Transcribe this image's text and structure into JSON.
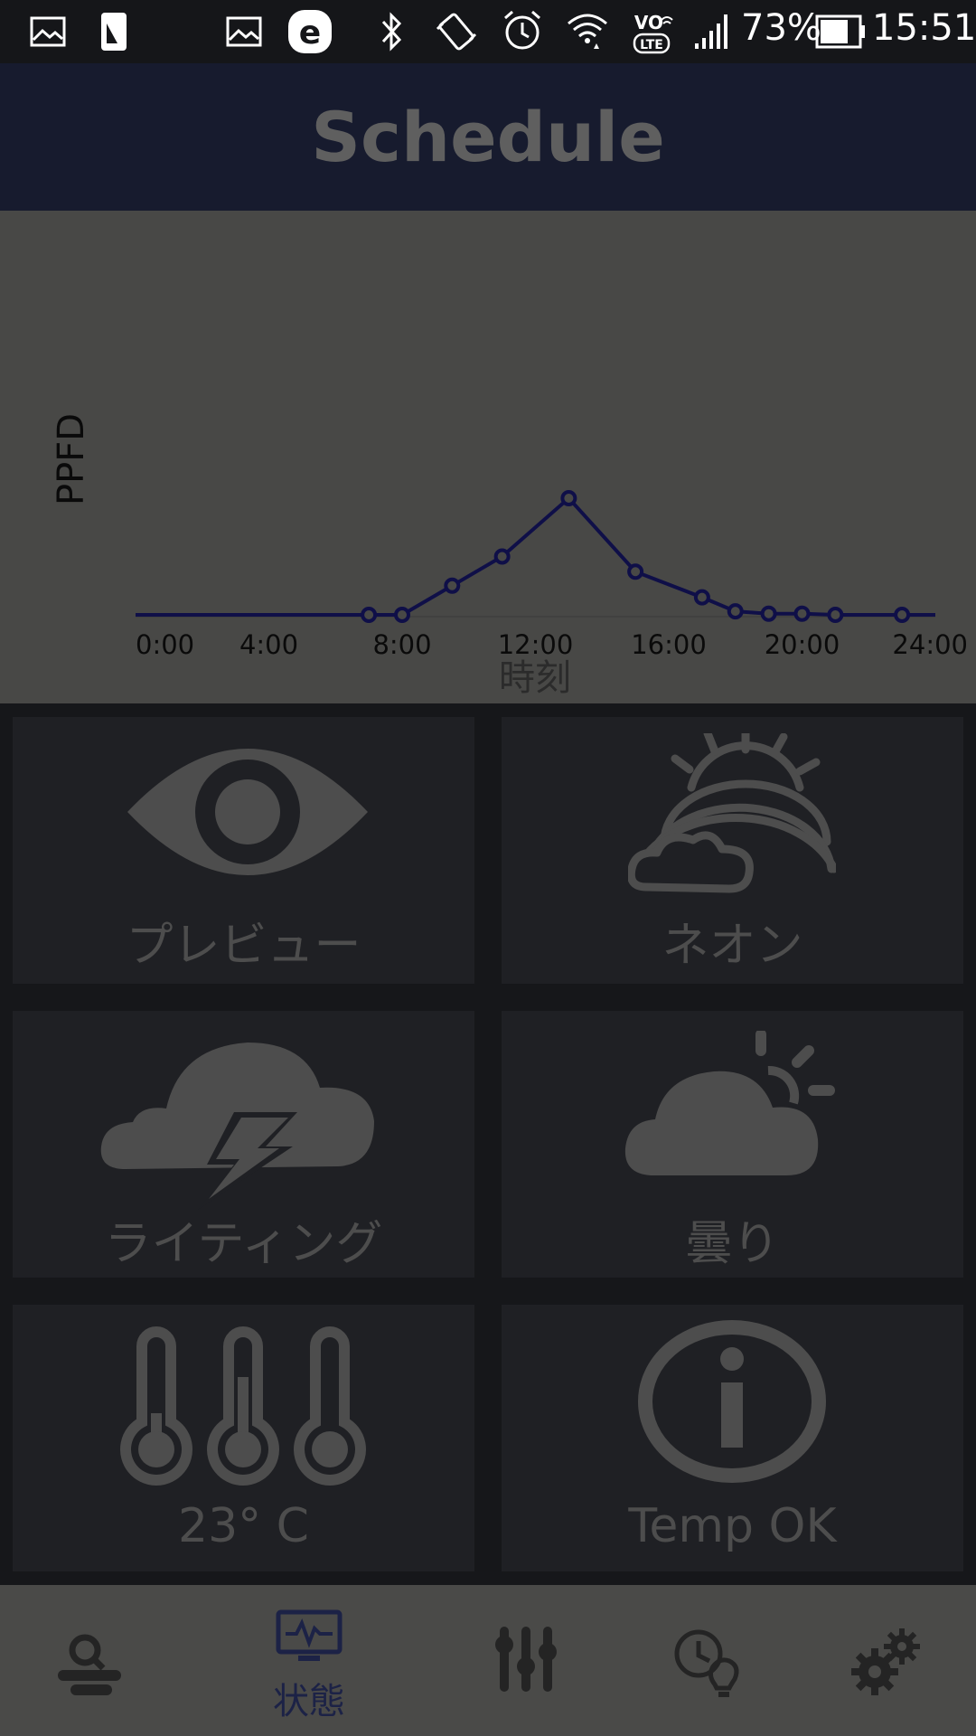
{
  "status_bar": {
    "battery_percent": "73%",
    "time": "15:51",
    "icons": [
      "gallery-icon",
      "sim-card-icon",
      "gallery-icon",
      "e-app-icon",
      "bluetooth-icon",
      "vibrate-icon",
      "alarm-icon",
      "wifi-icon",
      "volte-icon",
      "signal-icon",
      "battery-icon"
    ],
    "volte_top": "VO",
    "volte_bottom": "LTE"
  },
  "header": {
    "title": "Schedule"
  },
  "chart_data": {
    "type": "line",
    "ylabel": "PPFD",
    "xlabel": "時刻",
    "x_ticks": [
      "0:00",
      "4:00",
      "8:00",
      "12:00",
      "16:00",
      "20:00",
      "24:00"
    ],
    "xlim": [
      0,
      24
    ],
    "ylim": [
      0,
      100
    ],
    "line_color": "#0f0f48",
    "series": [
      {
        "x": [
          0,
          7,
          8,
          9.5,
          11,
          13,
          15,
          17,
          18,
          19,
          20,
          21,
          23,
          24
        ],
        "y": [
          0,
          0,
          0,
          25,
          50,
          100,
          37,
          15,
          3,
          1,
          1,
          0,
          0,
          0
        ],
        "markers": [
          false,
          true,
          true,
          true,
          true,
          true,
          true,
          true,
          true,
          true,
          true,
          true,
          true,
          false
        ]
      }
    ]
  },
  "tiles": [
    {
      "icon": "eye-icon",
      "label": "プレビュー"
    },
    {
      "icon": "sun-rainbow-cloud-icon",
      "label": "ネオン"
    },
    {
      "icon": "thunder-cloud-icon",
      "label": "ライティング"
    },
    {
      "icon": "partly-cloudy-icon",
      "label": "曇り"
    },
    {
      "icon": "thermometers-icon",
      "label": "23° C"
    },
    {
      "icon": "info-icon",
      "label": "Temp OK"
    }
  ],
  "bottom_nav": {
    "items": [
      {
        "icon": "search-device-icon",
        "label": ""
      },
      {
        "icon": "monitor-pulse-icon",
        "label": "状態",
        "active": true
      },
      {
        "icon": "sliders-icon",
        "label": ""
      },
      {
        "icon": "clock-bulb-icon",
        "label": ""
      },
      {
        "icon": "gears-icon",
        "label": ""
      }
    ]
  },
  "colors": {
    "active_nav": "#1c2246",
    "tile_icon": "#4d4d4d",
    "header_bg": "#171b2e",
    "chart_bg": "#484846"
  }
}
